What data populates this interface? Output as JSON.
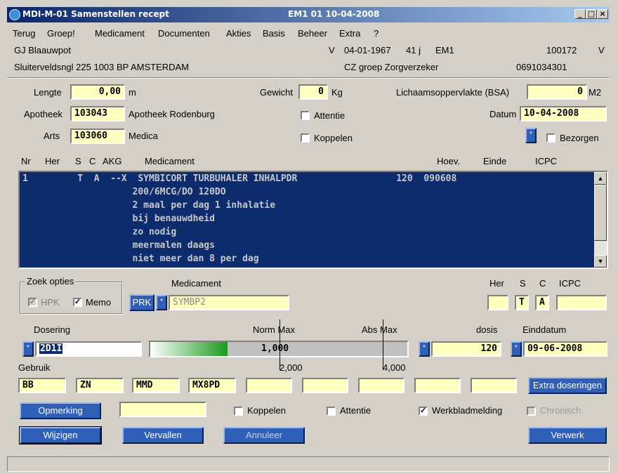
{
  "window": {
    "title": "MDI-M-01 Samenstellen recept",
    "subtitle": "EM1  01  10-04-2008",
    "min": "_",
    "max": "□",
    "close": "×"
  },
  "menu": [
    "Terug",
    "Groep!",
    "Medicament",
    "Documenten",
    "Akties",
    "Basis",
    "Beheer",
    "Extra",
    "?"
  ],
  "patient": {
    "name": "GJ Blaauwpot",
    "sex1": "V",
    "dob": "04-01-1967",
    "age": "41 j",
    "code": "EM1",
    "id": "100172",
    "sex2": "V",
    "address": "Sluiterveldsngl  225 1003 BP AMSTERDAM",
    "insurer": "CZ groep Zorgverzeker",
    "phone": "0691034301"
  },
  "form": {
    "lengte_label": "Lengte",
    "lengte": "0,00",
    "lengte_unit": "m",
    "gewicht_label": "Gewicht",
    "gewicht": "0",
    "gewicht_unit": "Kg",
    "bsa_label": "Lichaamsoppervlakte (BSA)",
    "bsa": "0",
    "bsa_unit": "M2",
    "apotheek_label": "Apotheek",
    "apotheek_code": "103043",
    "apotheek_name": "Apotheek Rodenburg",
    "attentie_label": "Attentie",
    "datum_label": "Datum",
    "datum": "10-04-2008",
    "arts_label": "Arts",
    "arts_code": "103060",
    "arts_name": "Medica",
    "koppelen_label": "Koppelen",
    "bezorgen_label": "Bezorgen"
  },
  "list": {
    "headers": {
      "nr": "Nr",
      "her": "Her",
      "s": "S",
      "c": "C",
      "akg": "AKG",
      "medicament": "Medicament",
      "hoev": "Hoev.",
      "einde": "Einde",
      "icpc": "ICPC"
    },
    "lines": [
      "1         T  A  --X  SYMBICORT TURBUHALER INHALPDR                  120  090608",
      "                    200/6MCG/DO 120DO",
      "                    2 maal per dag 1 inhalatie",
      "                    bij benauwdheid",
      "                    zo nodig",
      "                    meermalen daags",
      "                    niet meer dan 8 per dag"
    ]
  },
  "search": {
    "group_label": "Zoek opties",
    "hpk_label": "HPK",
    "memo_label": "Memo",
    "medicament_label": "Medicament",
    "prk_label": "PRK",
    "medicament_value": "SYMBP2",
    "her_label": "Her",
    "s_label": "S",
    "c_label": "C",
    "icpc_label": "ICPC",
    "s_value": "T",
    "c_value": "A"
  },
  "dosering": {
    "label": "Dosering",
    "norm_max_label": "Norm Max",
    "abs_max_label": "Abs Max",
    "dosis_label": "dosis",
    "einddatum_label": "Einddatum",
    "code": "2D1I",
    "value": "1,000",
    "progress": 0.3,
    "dosis": "120",
    "einddatum": "09-06-2008",
    "gebruik_label": "Gebruik",
    "tick1": "2,000",
    "tick2": "4,000"
  },
  "gebruik": [
    "BB",
    "ZN",
    "MMD",
    "MX8PD",
    "",
    "",
    "",
    "",
    ""
  ],
  "extra_doseringen": "Extra doseringen",
  "opmerking": "Opmerking",
  "bottom_checks": {
    "koppelen": "Koppelen",
    "attentie": "Attentie",
    "werkblad": "Werkbladmelding",
    "chronisch": "Chronisch"
  },
  "buttons": {
    "wijzigen": "Wijzigen",
    "vervallen": "Vervallen",
    "annuleer": "Annuleer",
    "verwerk": "Verwerk"
  },
  "asterisk": "*",
  "check_mark": "✓",
  "colors": {
    "title_start": "#0a246a",
    "field": "#ffffc0",
    "list_bg": "#0c2c6e",
    "button": "#2f5fb6"
  }
}
